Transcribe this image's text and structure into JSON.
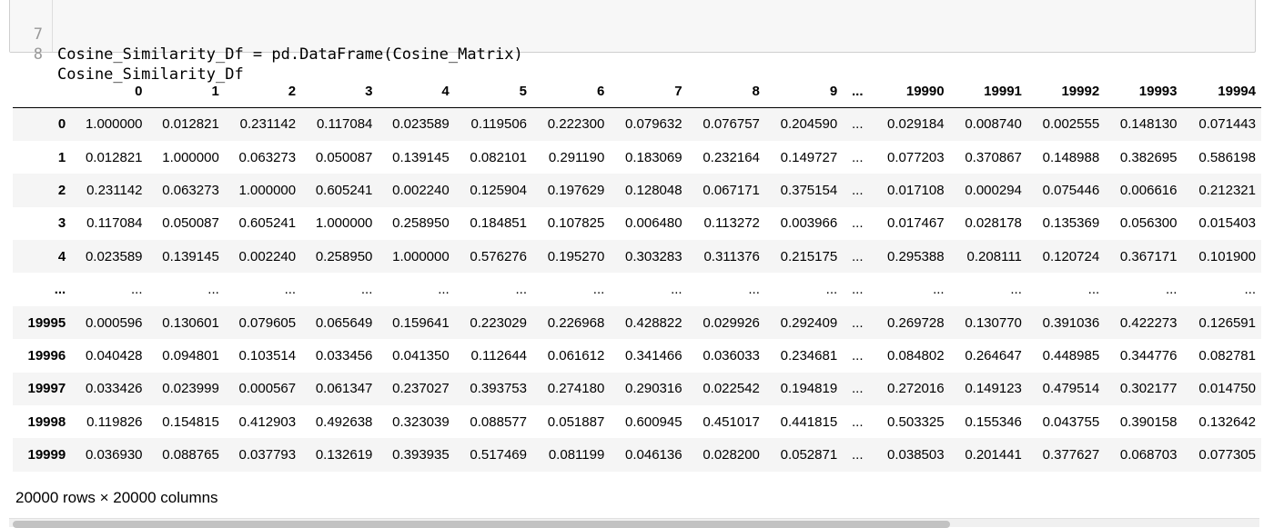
{
  "code_cell": {
    "lines": [
      {
        "number": "7",
        "text": "Cosine_Similarity_Df = pd.DataFrame(Cosine_Matrix)"
      },
      {
        "number": "8",
        "text": "Cosine_Similarity_Df"
      }
    ]
  },
  "dataframe": {
    "columns": [
      "",
      "0",
      "1",
      "2",
      "3",
      "4",
      "5",
      "6",
      "7",
      "8",
      "9",
      "...",
      "19990",
      "19991",
      "19992",
      "19993",
      "19994"
    ],
    "rows": [
      {
        "index": "0",
        "values": [
          "1.000000",
          "0.012821",
          "0.231142",
          "0.117084",
          "0.023589",
          "0.119506",
          "0.222300",
          "0.079632",
          "0.076757",
          "0.204590",
          "...",
          "0.029184",
          "0.008740",
          "0.002555",
          "0.148130",
          "0.071443"
        ]
      },
      {
        "index": "1",
        "values": [
          "0.012821",
          "1.000000",
          "0.063273",
          "0.050087",
          "0.139145",
          "0.082101",
          "0.291190",
          "0.183069",
          "0.232164",
          "0.149727",
          "...",
          "0.077203",
          "0.370867",
          "0.148988",
          "0.382695",
          "0.586198"
        ]
      },
      {
        "index": "2",
        "values": [
          "0.231142",
          "0.063273",
          "1.000000",
          "0.605241",
          "0.002240",
          "0.125904",
          "0.197629",
          "0.128048",
          "0.067171",
          "0.375154",
          "...",
          "0.017108",
          "0.000294",
          "0.075446",
          "0.006616",
          "0.212321"
        ]
      },
      {
        "index": "3",
        "values": [
          "0.117084",
          "0.050087",
          "0.605241",
          "1.000000",
          "0.258950",
          "0.184851",
          "0.107825",
          "0.006480",
          "0.113272",
          "0.003966",
          "...",
          "0.017467",
          "0.028178",
          "0.135369",
          "0.056300",
          "0.015403"
        ]
      },
      {
        "index": "4",
        "values": [
          "0.023589",
          "0.139145",
          "0.002240",
          "0.258950",
          "1.000000",
          "0.576276",
          "0.195270",
          "0.303283",
          "0.311376",
          "0.215175",
          "...",
          "0.295388",
          "0.208111",
          "0.120724",
          "0.367171",
          "0.101900"
        ]
      },
      {
        "index": "...",
        "values": [
          "...",
          "...",
          "...",
          "...",
          "...",
          "...",
          "...",
          "...",
          "...",
          "...",
          "...",
          "...",
          "...",
          "...",
          "...",
          "..."
        ]
      },
      {
        "index": "19995",
        "values": [
          "0.000596",
          "0.130601",
          "0.079605",
          "0.065649",
          "0.159641",
          "0.223029",
          "0.226968",
          "0.428822",
          "0.029926",
          "0.292409",
          "...",
          "0.269728",
          "0.130770",
          "0.391036",
          "0.422273",
          "0.126591"
        ]
      },
      {
        "index": "19996",
        "values": [
          "0.040428",
          "0.094801",
          "0.103514",
          "0.033456",
          "0.041350",
          "0.112644",
          "0.061612",
          "0.341466",
          "0.036033",
          "0.234681",
          "...",
          "0.084802",
          "0.264647",
          "0.448985",
          "0.344776",
          "0.082781"
        ]
      },
      {
        "index": "19997",
        "values": [
          "0.033426",
          "0.023999",
          "0.000567",
          "0.061347",
          "0.237027",
          "0.393753",
          "0.274180",
          "0.290316",
          "0.022542",
          "0.194819",
          "...",
          "0.272016",
          "0.149123",
          "0.479514",
          "0.302177",
          "0.014750"
        ]
      },
      {
        "index": "19998",
        "values": [
          "0.119826",
          "0.154815",
          "0.412903",
          "0.492638",
          "0.323039",
          "0.088577",
          "0.051887",
          "0.600945",
          "0.451017",
          "0.441815",
          "...",
          "0.503325",
          "0.155346",
          "0.043755",
          "0.390158",
          "0.132642"
        ]
      },
      {
        "index": "19999",
        "values": [
          "0.036930",
          "0.088765",
          "0.037793",
          "0.132619",
          "0.393935",
          "0.517469",
          "0.081199",
          "0.046136",
          "0.028200",
          "0.052871",
          "...",
          "0.038503",
          "0.201441",
          "0.377627",
          "0.068703",
          "0.077305"
        ]
      }
    ],
    "shape_text": "20000 rows × 20000 columns"
  }
}
